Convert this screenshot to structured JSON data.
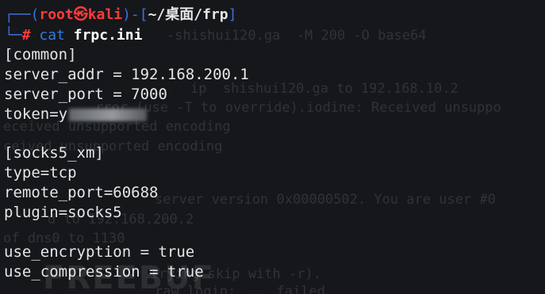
{
  "prompt": {
    "user_host": "root㉿kali",
    "cwd": "~/桌面/frp",
    "symbol": "#",
    "command": "cat",
    "argument": "frpc.ini"
  },
  "file_lines": [
    "[common]",
    "server_addr = 192.168.200.1",
    "server_port = 7000",
    "token=y",
    "",
    "[socks5_xm]",
    "type=tcp",
    "remote_port=60688",
    "plugin=socks5",
    "",
    "use_encryption = true",
    "use_compression = true"
  ],
  "ghost_lines": [
    "-shishui120.ga  -M 200 -O base64",
    "ip  shishui120.ga to 192.168.10.2",
    "rror (use -T to override).iodine: Received unsuppo",
    "eceived unsupported encoding",
    "ceived unsupported encoding",
    "server version 0x00000502. You are user #0",
    "d to 192.168.200.2",
    "of dns0 to 1130",
    "trying skip with -r).",
    "raw login: ... failed"
  ],
  "watermark": "FREEBUF",
  "colors": {
    "background": "#15171b",
    "text": "#e6e6e6",
    "prompt_red": "#ff3b3b",
    "prompt_blue": "#3c6fe0",
    "command_blue": "#2f7be8"
  }
}
